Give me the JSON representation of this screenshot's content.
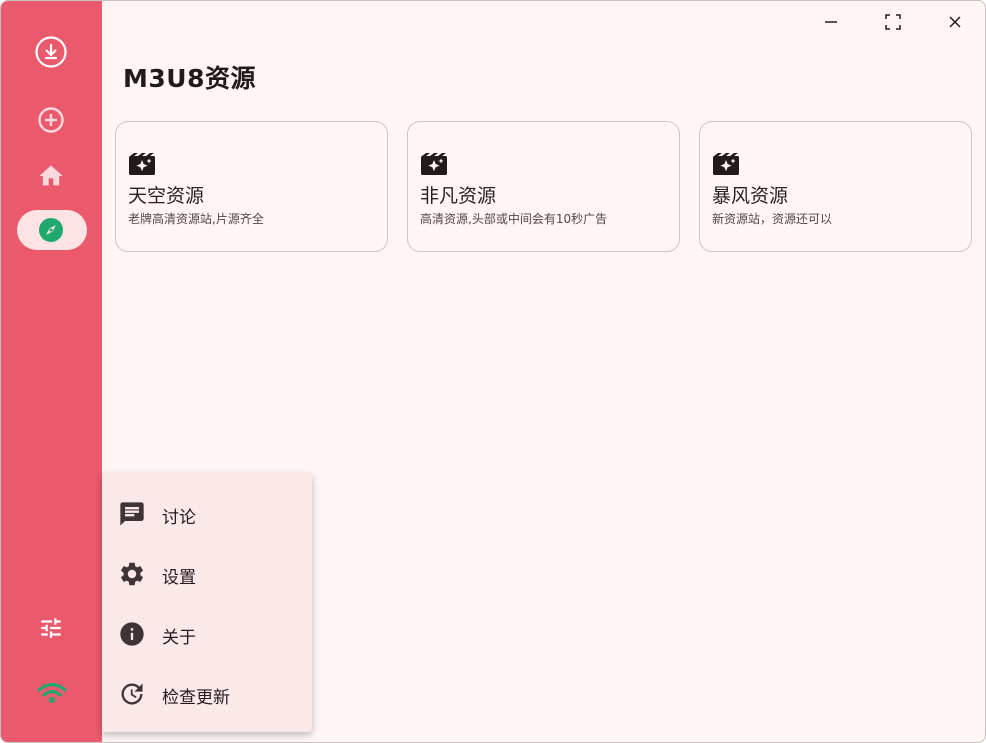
{
  "app": {
    "page_title": "M3U8资源"
  },
  "colors": {
    "rail": "#ea5a6c",
    "selected_pill": "#fde3e4",
    "accent_green": "#1fa870",
    "background": "#fff6f5"
  },
  "rail": {
    "items": [
      {
        "name": "app-logo",
        "icon": "download-circle-icon"
      },
      {
        "name": "add",
        "icon": "plus-circle-icon"
      },
      {
        "name": "home",
        "icon": "home-icon"
      },
      {
        "name": "explore",
        "icon": "compass-icon",
        "selected": true
      }
    ],
    "bottom": [
      {
        "name": "settings-sliders",
        "icon": "sliders-icon"
      },
      {
        "name": "network",
        "icon": "wifi-icon"
      }
    ]
  },
  "window_controls": [
    "minimize-icon",
    "maximize-icon",
    "close-icon"
  ],
  "sources": [
    {
      "title": "天空资源",
      "desc": "老牌高清资源站,片源齐全",
      "icon": "movie-clapper-icon"
    },
    {
      "title": "非凡资源",
      "desc": "高清资源,头部或中间会有10秒广告",
      "icon": "movie-clapper-icon"
    },
    {
      "title": "暴风资源",
      "desc": "新资源站，资源还可以",
      "icon": "movie-clapper-icon"
    }
  ],
  "menu": {
    "items": [
      {
        "label": "讨论",
        "icon": "chat-icon"
      },
      {
        "label": "设置",
        "icon": "gear-icon"
      },
      {
        "label": "关于",
        "icon": "info-icon"
      },
      {
        "label": "检查更新",
        "icon": "update-icon"
      }
    ]
  }
}
